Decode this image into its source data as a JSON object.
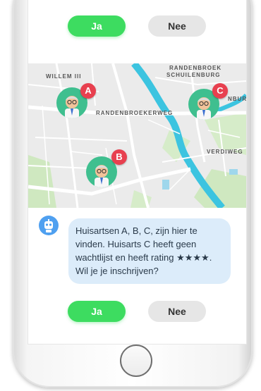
{
  "top_buttons": {
    "yes": "Ja",
    "no": "Nee"
  },
  "map": {
    "labels": {
      "willem": "WILLEM III",
      "randenbroek": "RANDENBROEK",
      "schuilenburg": "SCHUILENBURG",
      "randenbroekerweg": "RANDENBROEKERWEG",
      "nbur": "NBUR",
      "verdiweg": "VERDIWEG"
    },
    "markers": [
      {
        "letter": "A"
      },
      {
        "letter": "B"
      },
      {
        "letter": "C"
      }
    ]
  },
  "chat": {
    "message": "Huisartsen A, B, C, zijn hier te vinden. Huisarts C heeft geen wachtlijst en heeft rating ★★★★. Wil je je inschrijven?"
  },
  "bottom_buttons": {
    "yes": "Ja",
    "no": "Nee"
  },
  "colors": {
    "accent": "#3ddc60",
    "badge": "#e8404f",
    "marker": "#3fbf8f",
    "bubble": "#dcecfa",
    "river": "#3cc4e0"
  }
}
